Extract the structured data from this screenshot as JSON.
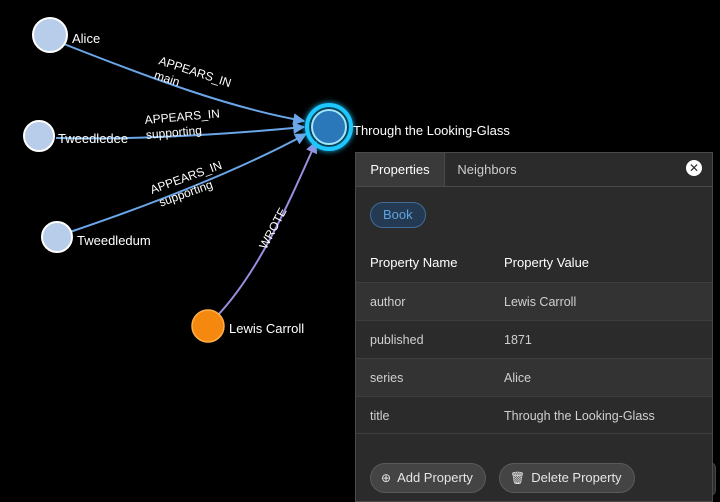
{
  "graph": {
    "nodes": [
      {
        "id": "alice",
        "label": "Alice",
        "color": "#b7cdea"
      },
      {
        "id": "tweedledee",
        "label": "Tweedledee",
        "color": "#b7cdea"
      },
      {
        "id": "tweedledum",
        "label": "Tweedledum",
        "color": "#b7cdea"
      },
      {
        "id": "lewis",
        "label": "Lewis Carroll",
        "color": "#f5890f"
      },
      {
        "id": "book",
        "label": "Through the Looking-Glass",
        "color": "#2a78b9",
        "selected": true
      }
    ],
    "edges": [
      {
        "from": "alice",
        "to": "book",
        "label": "APPEARS_IN",
        "sublabel": "main"
      },
      {
        "from": "tweedledee",
        "to": "book",
        "label": "APPEARS_IN",
        "sublabel": "supporting"
      },
      {
        "from": "tweedledum",
        "to": "book",
        "label": "APPEARS_IN",
        "sublabel": "supporting"
      },
      {
        "from": "lewis",
        "to": "book",
        "label": "WROTE"
      }
    ],
    "colors": {
      "appears_in_edge": "#6aa6e8",
      "wrote_edge": "#9a8ee0",
      "selection_glow": "#1ec8ff"
    }
  },
  "panel": {
    "tabs": {
      "properties": "Properties",
      "neighbors": "Neighbors"
    },
    "close_icon": "close-icon",
    "badge": "Book",
    "headers": {
      "name": "Property Name",
      "value": "Property Value"
    },
    "rows": [
      {
        "name": "author",
        "value": "Lewis Carroll"
      },
      {
        "name": "published",
        "value": "1871"
      },
      {
        "name": "series",
        "value": "Alice"
      },
      {
        "name": "title",
        "value": "Through the Looking-Glass"
      }
    ],
    "add_label": "Add Property",
    "delete_label": "Delete Property"
  }
}
